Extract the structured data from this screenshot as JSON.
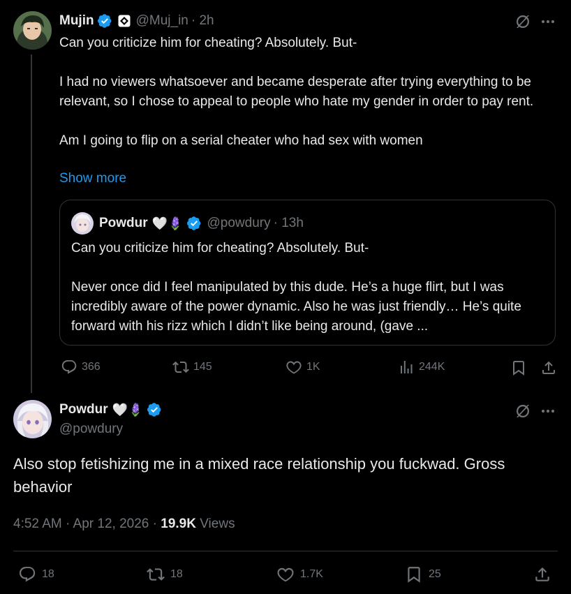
{
  "parent": {
    "name": "Mujin",
    "handle": "@Muj_in",
    "time": "· 2h",
    "text": "Can you criticize him for cheating? Absolutely. But-\n\nI had no viewers whatsoever and became desperate after trying everything to be relevant, so I chose to appeal to people who hate my gender in order to pay rent.\n\nAm I going to flip on a serial cheater who had sex with women",
    "show_more": "Show more",
    "quote": {
      "name": "Powdur",
      "emoji": "🤍🪻",
      "handle": "@powdury",
      "time": "· 13h",
      "text": "Can you criticize him for cheating? Absolutely. But-\n\nNever once did I feel manipulated by this dude. He’s a huge flirt, but I was incredibly aware of the power dynamic. Also he was just friendly… He’s quite forward with his rizz which I didn’t like being around, (gave ..."
    },
    "actions": {
      "replies": "366",
      "reposts": "145",
      "likes": "1K",
      "views": "244K"
    }
  },
  "main": {
    "name": "Powdur",
    "emoji": "🤍🪻",
    "handle": "@powdury",
    "text": "Also stop fetishizing me in a mixed race relationship you fuckwad. Gross behavior",
    "timestamp": "4:52 AM · Apr 12, 2026 · ",
    "views_count": "19.9K",
    "views_label": " Views",
    "actions": {
      "replies": "18",
      "reposts": "18",
      "likes": "1.7K",
      "bookmarks": "25"
    }
  },
  "colors": {
    "accent": "#1d9bf0",
    "text": "#e7e9ea",
    "muted": "#71767b",
    "border": "#2f3336"
  },
  "icons": [
    "verified-badge-icon",
    "grok-icon",
    "more-icon",
    "reply-icon",
    "repost-icon",
    "like-icon",
    "views-icon",
    "bookmark-icon",
    "share-icon"
  ]
}
